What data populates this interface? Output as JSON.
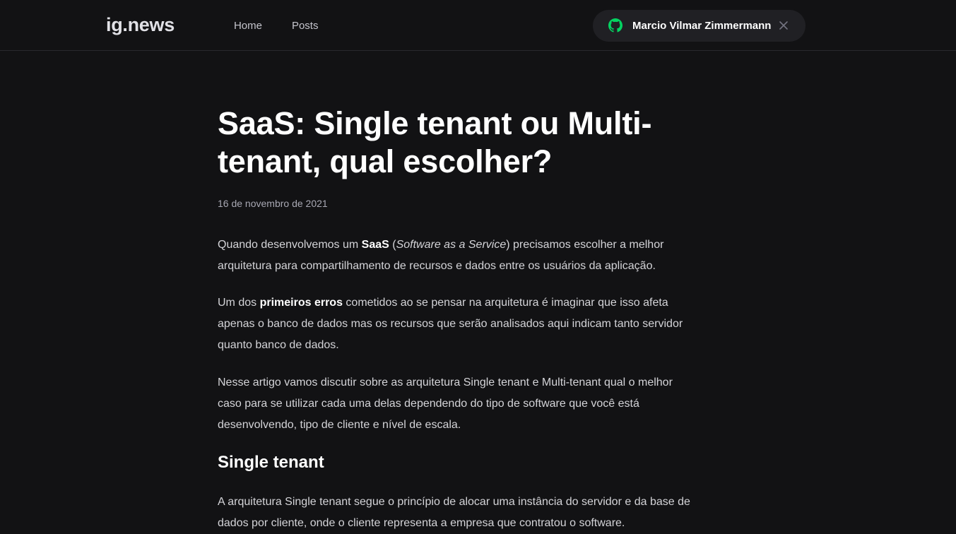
{
  "header": {
    "logo": "ig.news",
    "nav": {
      "home": "Home",
      "posts": "Posts"
    },
    "user": {
      "name": "Marcio Vilmar Zimmermann",
      "icon": "github-icon",
      "icon_color": "#04d361",
      "close_icon": "close-icon"
    }
  },
  "post": {
    "title": "SaaS: Single tenant ou Multi-tenant, qual escolher?",
    "date": "16 de novembro de 2021",
    "p1": {
      "t1": "Quando desenvolvemos um ",
      "b1": "SaaS",
      "t2": " (",
      "i1": "Software as a Service",
      "t3": ") precisamos escolher a melhor arquitetura para compartilhamento de recursos e dados entre os usuários da aplicação."
    },
    "p2": {
      "t1": "Um dos ",
      "b1": "primeiros erros",
      "t2": " cometidos ao se pensar na arquitetura é imaginar que isso afeta apenas o banco de dados mas os recursos que serão analisados aqui indicam tanto servidor quanto banco de dados."
    },
    "p3": "Nesse artigo vamos discutir sobre as arquitetura Single tenant e Multi-tenant qual o melhor caso para se utilizar cada uma delas dependendo do tipo de software que você está desenvolvendo, tipo de cliente e nível de escala.",
    "h2": "Single tenant",
    "p4": "A arquitetura Single tenant segue o princípio de alocar uma instância do servidor e da base de dados por cliente, onde o cliente representa a empresa que contratou o software."
  }
}
